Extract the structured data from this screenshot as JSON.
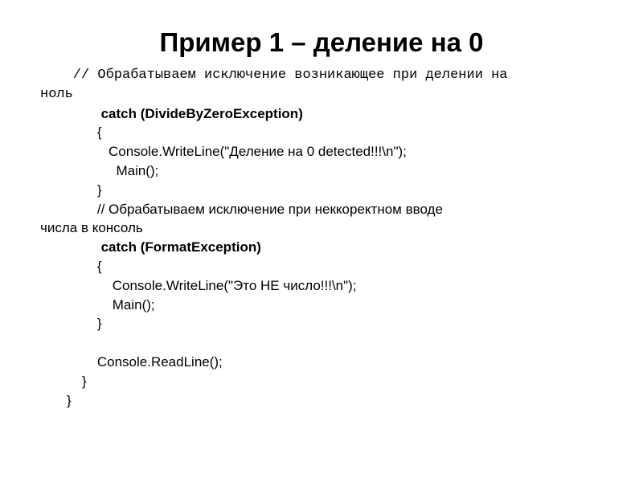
{
  "title": "Пример 1 – деление на 0",
  "lines": {
    "c1a": "    // Обрабатываем исключение возникающее при делении на",
    "c1b": "ноль",
    "l1": "                catch (DivideByZeroException)",
    "l2": "               {",
    "l3": "                  Console.WriteLine(\"Деление на 0 detected!!!\\n\");",
    "l4": "                    Main();",
    "l5": "               }",
    "c2a": "               // Обрабатываем исключение при неккоректном вводе",
    "c2b": "числа в консоль",
    "l6": "                catch (FormatException)",
    "l7": "               {",
    "l8": "                   Console.WriteLine(\"Это НЕ число!!!\\n\");",
    "l9": "                   Main();",
    "l10": "               }",
    "blank": " ",
    "l11": "               Console.ReadLine();",
    "l12": "           }",
    "l13": "       }"
  }
}
